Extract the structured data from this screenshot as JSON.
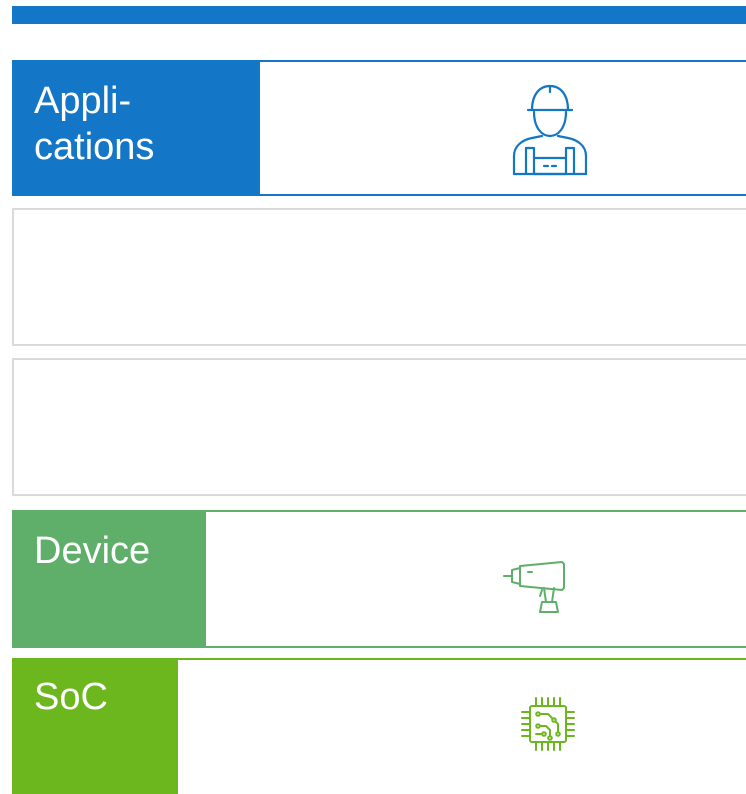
{
  "colors": {
    "blue": "#1476c6",
    "green": "#5faf6a",
    "lime": "#6db71e"
  },
  "layers": [
    {
      "id": "applications",
      "label_line1": "Appli-",
      "label_line2": "cations",
      "icon": "worker-icon"
    },
    {
      "id": "empty-1",
      "icon": ""
    },
    {
      "id": "empty-2",
      "icon": ""
    },
    {
      "id": "device",
      "label": "Device",
      "icon": "power-drill-icon"
    },
    {
      "id": "soc",
      "label": "SoC",
      "icon": "chip-icon"
    }
  ]
}
